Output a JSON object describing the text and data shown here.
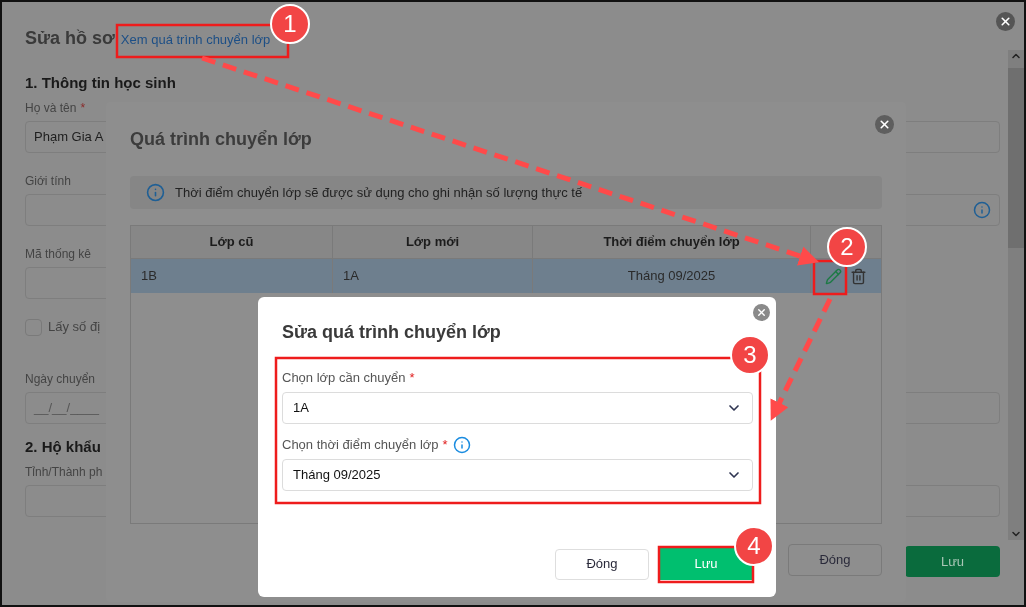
{
  "profile_dialog": {
    "title": "Sửa hồ sơ",
    "link": "Xem quá trình chuyển lớp",
    "items": [
      {
        "kind": "heading",
        "text": "1. Thông tin học sinh"
      },
      {
        "kind": "field",
        "label": "Họ và tên",
        "required_mark": "*",
        "value": "Phạm Gia A"
      },
      {
        "kind": "field",
        "label": "Giới tính",
        "info_icon": true
      },
      {
        "kind": "short_field",
        "label": "Mã thống kê"
      },
      {
        "kind": "checkbox",
        "label": "Lấy số đị",
        "checked": false
      },
      {
        "kind": "field",
        "label": "Ngày chuyển",
        "placeholder": "__/__/____"
      },
      {
        "kind": "heading",
        "text": "2. Hộ khẩu"
      },
      {
        "kind": "field",
        "label": "Tỉnh/Thành ph"
      }
    ],
    "save_button": "Lưu"
  },
  "history_dialog": {
    "title": "Quá trình chuyển lớp",
    "notice": "Thời điểm chuyển lớp sẽ được sử dụng cho ghi nhận số lượng thực tế",
    "columns": [
      "Lớp cũ",
      "Lớp mới",
      "Thời điểm chuyển lớp"
    ],
    "rows": [
      {
        "cells": [
          "1B",
          "1A",
          "Tháng 09/2025"
        ],
        "selected": true
      }
    ],
    "close_button": "Đóng"
  },
  "edit_dialog": {
    "title": "Sửa quá trình chuyển lớp",
    "fields": [
      {
        "label": "Chọn lớp cần chuyển",
        "required_mark": "*",
        "value": "1A"
      },
      {
        "label": "Chọn thời điểm chuyển lớp",
        "required_mark": "*",
        "value": "Tháng 09/2025",
        "info_icon": true
      }
    ],
    "buttons": [
      {
        "label": "Đóng",
        "kind": "secondary"
      },
      {
        "label": "Lưu",
        "kind": "primary"
      }
    ]
  },
  "callouts": [
    "1",
    "2",
    "3",
    "4"
  ]
}
